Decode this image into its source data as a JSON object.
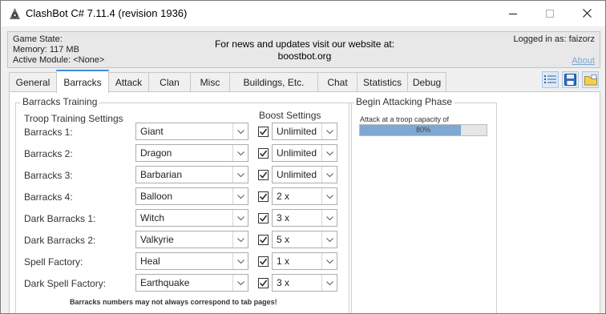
{
  "window": {
    "title": "ClashBot C# 7.11.4 (revision 1936)"
  },
  "header": {
    "game_state_label": "Game State:",
    "memory": "Memory: 117 MB",
    "active_module": "Active Module: <None>",
    "news_line1": "For news and updates visit our website at:",
    "news_line2": "boostbot.org",
    "logged_in": "Logged in as: faizorz",
    "about_link": "About"
  },
  "tabs": [
    {
      "label": "General"
    },
    {
      "label": "Barracks",
      "active": true
    },
    {
      "label": "Attack"
    },
    {
      "label": "Clan"
    },
    {
      "label": "Misc"
    },
    {
      "label": "Buildings, Etc."
    },
    {
      "label": "Chat"
    },
    {
      "label": "Statistics"
    },
    {
      "label": "Debug"
    }
  ],
  "toolbar_icons": [
    "list-icon",
    "save-icon",
    "folder-icon"
  ],
  "barracks": {
    "group_title": "Barracks Training",
    "troop_settings_title": "Troop Training Settings",
    "boost_settings_title": "Boost Settings",
    "rows": [
      {
        "label": "Barracks 1:",
        "troop": "Giant",
        "boost_checked": true,
        "boost": "Unlimited"
      },
      {
        "label": "Barracks 2:",
        "troop": "Dragon",
        "boost_checked": true,
        "boost": "Unlimited"
      },
      {
        "label": "Barracks 3:",
        "troop": "Barbarian",
        "boost_checked": true,
        "boost": "Unlimited"
      },
      {
        "label": "Barracks 4:",
        "troop": "Balloon",
        "boost_checked": true,
        "boost": "2 x"
      },
      {
        "label": "Dark Barracks 1:",
        "troop": "Witch",
        "boost_checked": true,
        "boost": "3 x"
      },
      {
        "label": "Dark Barracks 2:",
        "troop": "Valkyrie",
        "boost_checked": true,
        "boost": "5 x"
      },
      {
        "label": "Spell Factory:",
        "troop": "Heal",
        "boost_checked": true,
        "boost": "1 x"
      },
      {
        "label": "Dark Spell Factory:",
        "troop": "Earthquake",
        "boost_checked": true,
        "boost": "3 x"
      }
    ],
    "footnote": "Barracks numbers may not always correspond to tab pages!"
  },
  "attacking": {
    "group_title": "Begin Attacking Phase",
    "capacity_label": "Attack at a troop capacity of",
    "capacity_text": "80%",
    "capacity_fraction": 0.8
  },
  "colors": {
    "accent": "#3c8dde",
    "progress_fill": "#7ea7d3",
    "link": "#7aa7d8"
  }
}
